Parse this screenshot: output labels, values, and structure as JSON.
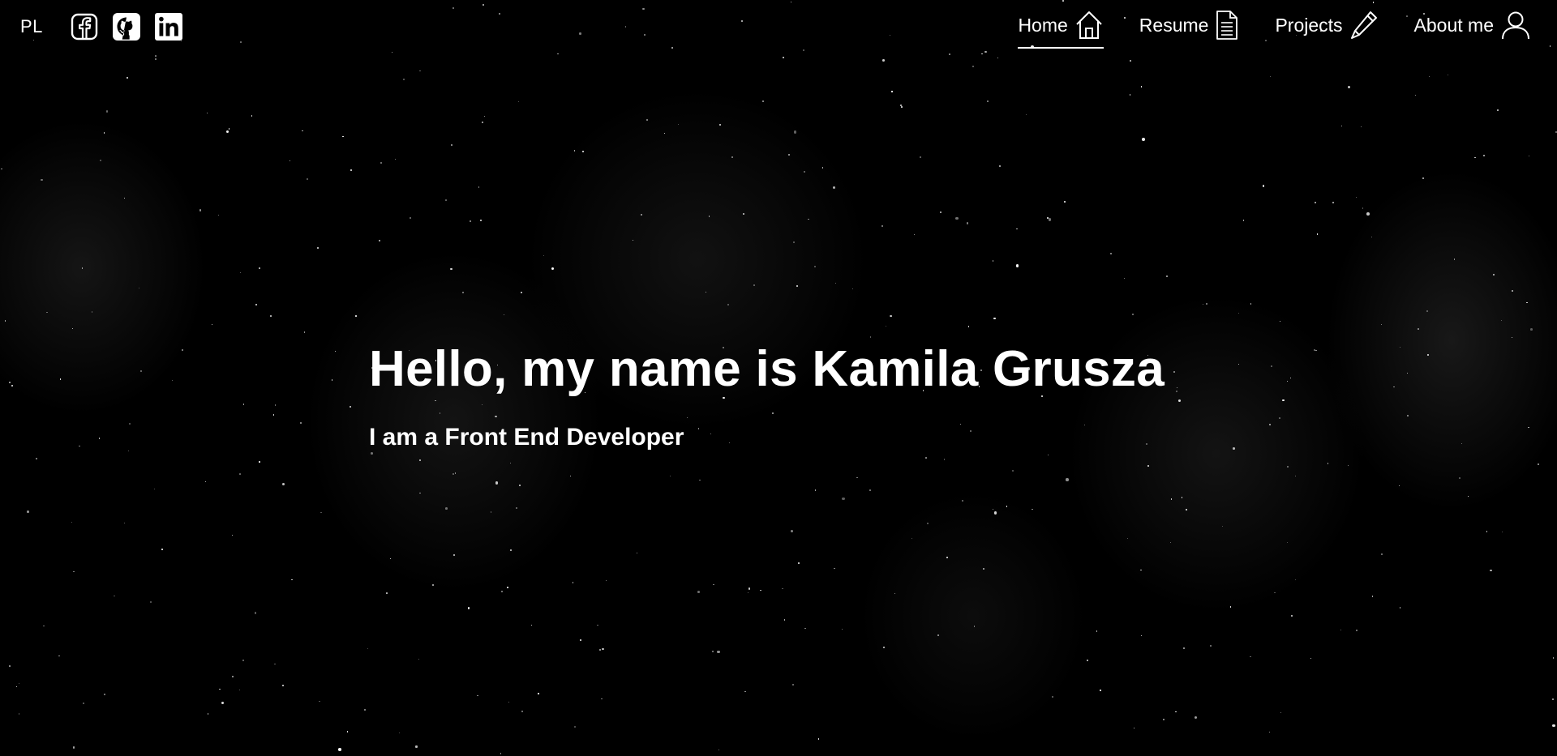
{
  "header": {
    "lang_label": "PL",
    "social": [
      {
        "icon": "facebook-icon"
      },
      {
        "icon": "github-icon"
      },
      {
        "icon": "linkedin-icon"
      }
    ],
    "nav": [
      {
        "label": "Home",
        "icon": "home-icon",
        "active": true
      },
      {
        "label": "Resume",
        "icon": "document-icon",
        "active": false
      },
      {
        "label": "Projects",
        "icon": "pencil-icon",
        "active": false
      },
      {
        "label": "About me",
        "icon": "user-icon",
        "active": false
      }
    ]
  },
  "hero": {
    "title": "Hello, my name is Kamila Grusza",
    "subtitle": "I am a Front End Developer"
  },
  "colors": {
    "background": "#000000",
    "text": "#ffffff"
  }
}
